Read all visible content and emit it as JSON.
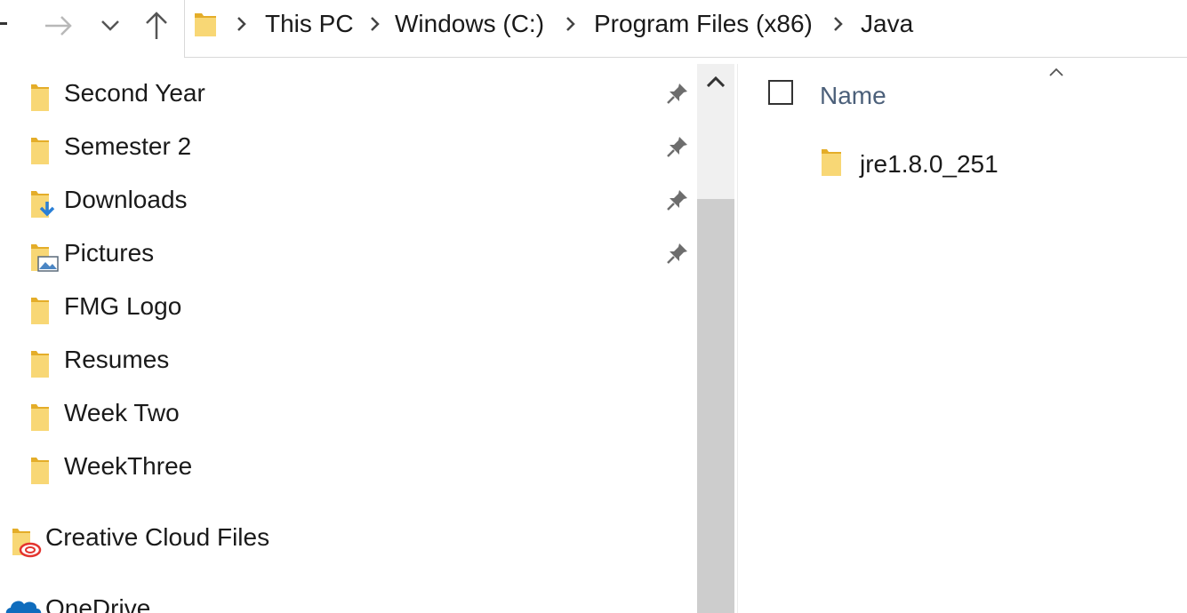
{
  "address_bar": {
    "breadcrumbs": [
      "This PC",
      "Windows (C:)",
      "Program Files (x86)",
      "Java"
    ]
  },
  "navigation_pane": {
    "quick_access_items": [
      {
        "label": "Second Year",
        "icon": "folder-icon",
        "pinned": true
      },
      {
        "label": "Semester 2",
        "icon": "folder-icon",
        "pinned": true
      },
      {
        "label": "Downloads",
        "icon": "downloads-folder-icon",
        "pinned": true
      },
      {
        "label": "Pictures",
        "icon": "pictures-folder-icon",
        "pinned": true
      },
      {
        "label": "FMG Logo",
        "icon": "folder-icon",
        "pinned": false
      },
      {
        "label": "Resumes",
        "icon": "folder-icon",
        "pinned": false
      },
      {
        "label": "Week Two",
        "icon": "folder-icon",
        "pinned": false
      },
      {
        "label": "WeekThree",
        "icon": "folder-icon",
        "pinned": false
      }
    ],
    "root_items": [
      {
        "label": "Creative Cloud Files",
        "icon": "creative-cloud-folder-icon"
      },
      {
        "label": "OneDrive",
        "icon": "onedrive-cloud-icon"
      }
    ]
  },
  "content": {
    "column_header": "Name",
    "files": [
      {
        "name": "jre1.8.0_251",
        "icon": "folder-icon"
      }
    ]
  },
  "colors": {
    "folder_yellow": "#f8d775",
    "folder_dark": "#e4ad29",
    "header_text": "#4c607a",
    "scroll_thumb": "#cdcdcd"
  }
}
